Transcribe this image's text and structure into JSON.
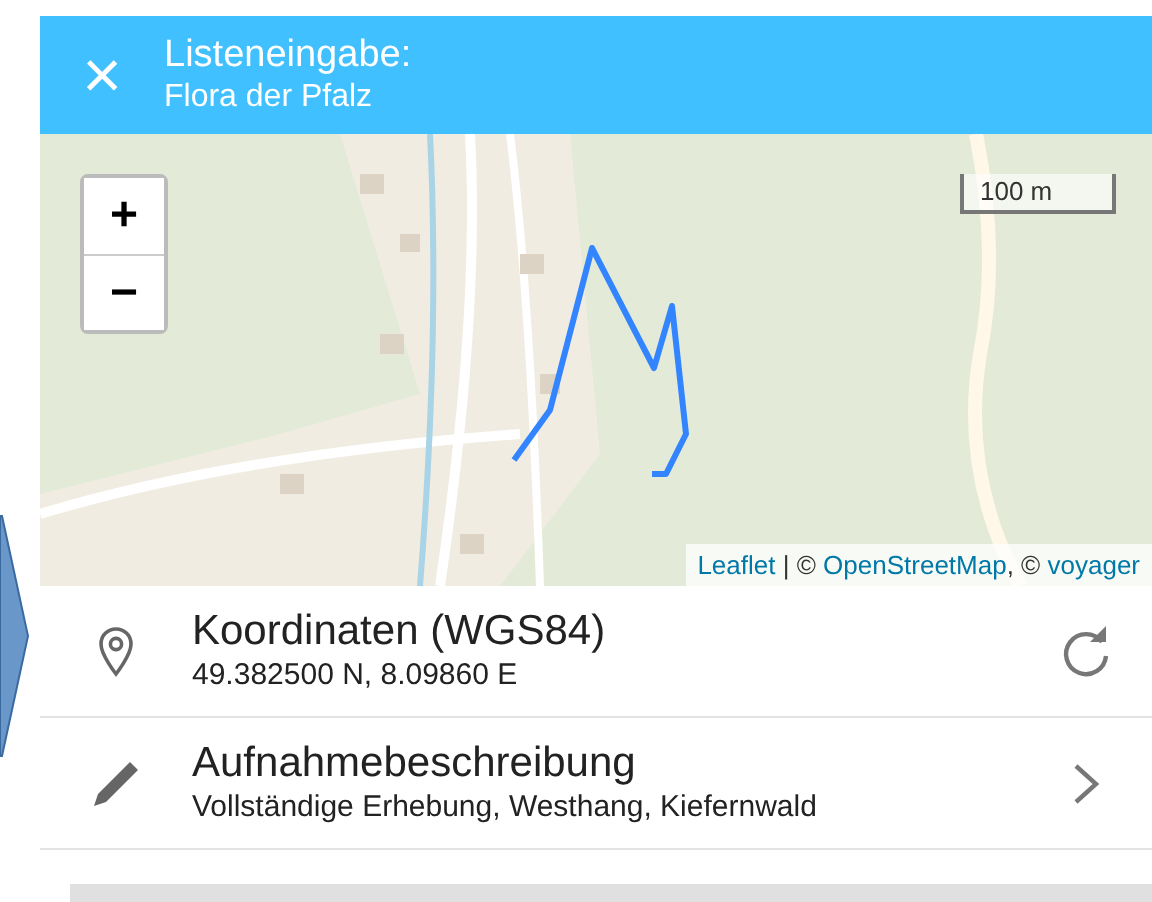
{
  "header": {
    "close_icon": "×",
    "title": "Listeneingabe:",
    "subtitle": "Flora der Pfalz"
  },
  "map": {
    "zoom_in": "+",
    "zoom_out": "−",
    "scale": "100 m",
    "attribution": [
      {
        "text": "Leaflet",
        "kind": "link"
      },
      {
        "text": " | © ",
        "kind": "text"
      },
      {
        "text": "OpenStreetMap",
        "kind": "link"
      },
      {
        "text": ", © ",
        "kind": "text"
      },
      {
        "text": "voyager",
        "kind": "link"
      }
    ]
  },
  "rows": [
    {
      "kind": "location",
      "title": "Koordinaten (WGS84)",
      "value": "49.382500 N, 8.09860 E"
    },
    {
      "kind": "description",
      "title": "Aufnahmebeschreibung",
      "value": "Vollständige Erhebung, Westhang, Kiefernwald"
    }
  ]
}
